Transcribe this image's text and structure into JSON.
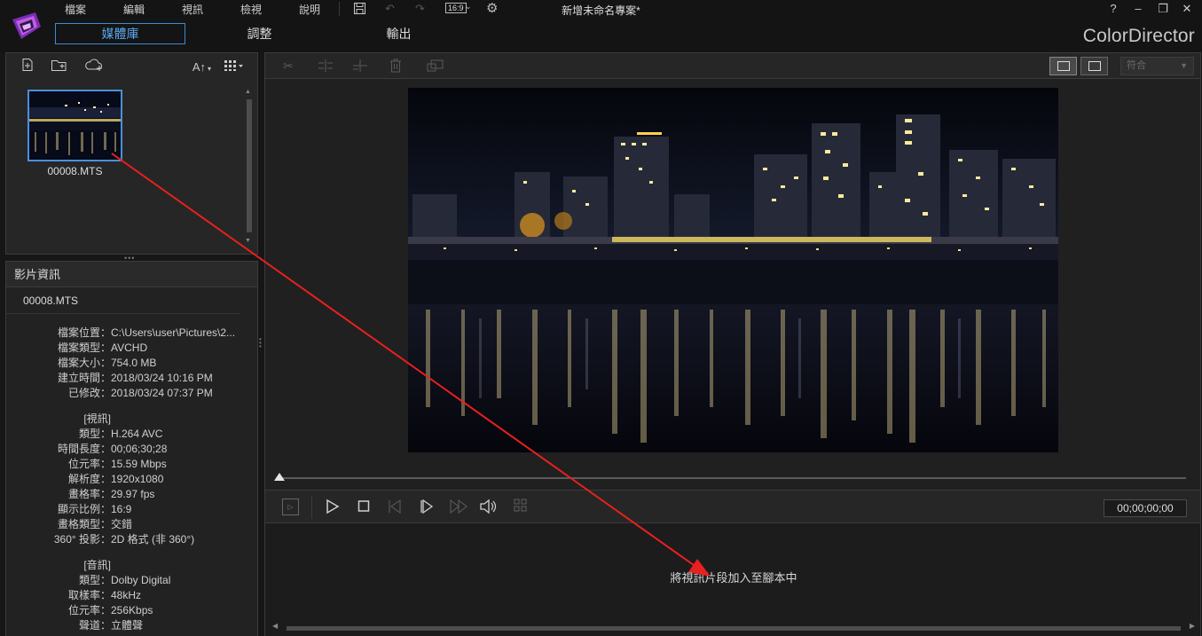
{
  "app": {
    "project_title": "新增未命名專案*",
    "brand": "ColorDirector",
    "menu": [
      "檔案",
      "編輯",
      "視訊",
      "檢視",
      "說明"
    ],
    "aspect_ratio": "16:9",
    "help": "?",
    "modes": [
      "媒體庫",
      "調整",
      "輸出"
    ],
    "active_mode": "媒體庫"
  },
  "library": {
    "sort_label": "A↑",
    "items": [
      {
        "name": "00008.MTS"
      }
    ]
  },
  "info_panel": {
    "title": "影片資訊",
    "file": "00008.MTS",
    "general": [
      {
        "k": "檔案位置：",
        "v": "C:\\Users\\user\\Pictures\\2..."
      },
      {
        "k": "檔案類型：",
        "v": "AVCHD"
      },
      {
        "k": "檔案大小：",
        "v": "754.0 MB"
      },
      {
        "k": "建立時間：",
        "v": "2018/03/24 10:16 PM"
      },
      {
        "k": "已修改：",
        "v": "2018/03/24 07:37 PM"
      }
    ],
    "video_section": "[視訊]",
    "video": [
      {
        "k": "類型：",
        "v": "H.264 AVC"
      },
      {
        "k": "時間長度：",
        "v": "00;06;30;28"
      },
      {
        "k": "位元率：",
        "v": "15.59 Mbps"
      },
      {
        "k": "解析度：",
        "v": "1920x1080"
      },
      {
        "k": "畫格率：",
        "v": "29.97 fps"
      },
      {
        "k": "顯示比例：",
        "v": "16:9"
      },
      {
        "k": "畫格類型：",
        "v": "交錯"
      },
      {
        "k": "360° 投影：",
        "v": "2D 格式 (非 360°)"
      }
    ],
    "audio_section": "[音訊]",
    "audio": [
      {
        "k": "類型：",
        "v": "Dolby Digital"
      },
      {
        "k": "取樣率：",
        "v": "48kHz"
      },
      {
        "k": "位元率：",
        "v": "256Kbps"
      },
      {
        "k": "聲道：",
        "v": "立體聲"
      }
    ]
  },
  "viewer": {
    "fit_option": "符合",
    "timecode": "00;00;00;00"
  },
  "script_area": {
    "hint": "將視訊片段加入至腳本中"
  },
  "colors": {
    "accent": "#3d8bd4",
    "arrow": "#e8201f"
  }
}
